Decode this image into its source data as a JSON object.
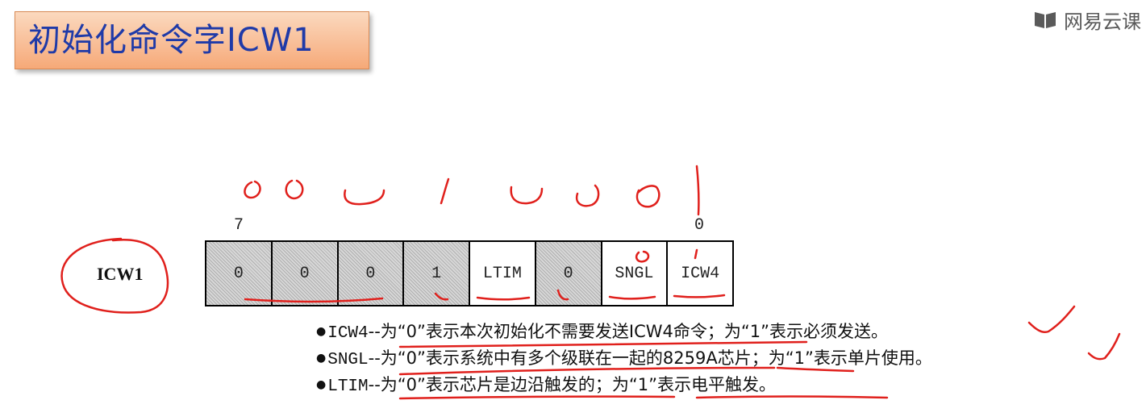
{
  "title": "初始化命令字ICW1",
  "brand": {
    "name": "网易云课",
    "icon": "book-icon"
  },
  "register": {
    "name": "ICW1",
    "msb_label": "7",
    "lsb_label": "0",
    "bits": [
      "0",
      "0",
      "0",
      "1",
      "LTIM",
      "0",
      "SNGL",
      "ICW4"
    ],
    "shaded": [
      true,
      true,
      true,
      true,
      false,
      true,
      false,
      false
    ]
  },
  "notes": [
    {
      "name": "ICW4",
      "text": "--为“0”表示本次初始化不需要发送ICW4命令；为“1”表示必须发送。"
    },
    {
      "name": "SNGL",
      "text": "--为“0”表示系统中有多个级联在一起的8259A芯片；为“1”表示单片使用。"
    },
    {
      "name": "LTIM",
      "text": "--为“0”表示芯片是边沿触发的；为“1”表示电平触发。"
    }
  ],
  "colors": {
    "title_text": "#1f3aa8",
    "ink": "#e0201c",
    "title_bg": "#f6a978"
  }
}
